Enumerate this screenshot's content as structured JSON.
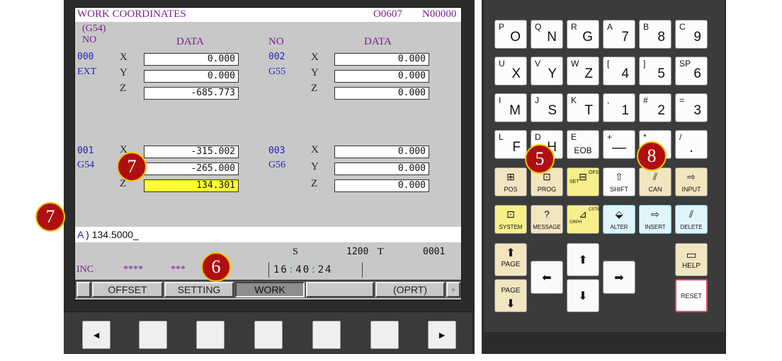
{
  "screen": {
    "title": "WORK COORDINATES",
    "program_no": "O0607",
    "sequence_no": "N00000",
    "header": {
      "g54_tag": "(G54)",
      "no_left": "NO",
      "data_left": "DATA",
      "no_right": "NO",
      "data_right": "DATA"
    },
    "blocks": [
      {
        "no": "000",
        "code": "EXT",
        "x": "0.000",
        "y": "0.000",
        "z": "-685.773"
      },
      {
        "no": "002",
        "code": "G55",
        "x": "0.000",
        "y": "0.000",
        "z": "0.000"
      },
      {
        "no": "001",
        "code": "G54",
        "x": "-315.002",
        "y": "-265.000",
        "z": "134.301"
      },
      {
        "no": "003",
        "code": "G56",
        "x": "0.000",
        "y": "0.000",
        "z": "0.000"
      }
    ],
    "axes": {
      "x": "X",
      "y": "Y",
      "z": "Z"
    },
    "input_prefix": "A",
    "input_value": " ) 134.5000_",
    "spindle_label": "S",
    "spindle_value": "1200",
    "tool_label": "T",
    "tool_value": "0001",
    "mode": "INC",
    "stars1": "****",
    "stars2": "***",
    "clock_h": "16",
    "clock_m": "40",
    "clock_s": "24",
    "softkeys": [
      "OFFSET",
      "SETTING",
      "WORK",
      "",
      "(OPRT)",
      "+"
    ]
  },
  "hw_keys": {
    "left": "◄",
    "right": "►"
  },
  "keypad": {
    "row1": [
      {
        "sm": "P",
        "lg": "O"
      },
      {
        "sm": "Q",
        "lg": "N"
      },
      {
        "sm": "R",
        "lg": "G"
      },
      {
        "sm": "A",
        "lg": "7"
      },
      {
        "sm": "B",
        "lg": "8"
      },
      {
        "sm": "C",
        "lg": "9"
      }
    ],
    "row2": [
      {
        "sm": "U",
        "lg": "X"
      },
      {
        "sm": "V",
        "lg": "Y"
      },
      {
        "sm": "W",
        "lg": "Z"
      },
      {
        "sm": "[",
        "lg": "4"
      },
      {
        "sm": "]",
        "lg": "5"
      },
      {
        "sm": "SP",
        "lg": "6"
      }
    ],
    "row3": [
      {
        "sm": "I",
        "lg": "M"
      },
      {
        "sm": "J",
        "lg": "S"
      },
      {
        "sm": "K",
        "lg": "T"
      },
      {
        "sm": ",",
        "lg": "1"
      },
      {
        "sm": "#",
        "lg": "2"
      },
      {
        "sm": "=",
        "lg": "3"
      }
    ],
    "row4": [
      {
        "sm": "L",
        "lg": "F"
      },
      {
        "sm": "D",
        "lg": "H"
      },
      {
        "sm": "E",
        "lg": "EOB"
      },
      {
        "sm": "+",
        "lg": "—"
      },
      {
        "sm": "*",
        "lg": "0"
      },
      {
        "sm": "/",
        "lg": "."
      }
    ],
    "func1": [
      "POS",
      "PROG",
      "OFS/SET",
      "SHIFT",
      "CAN",
      "INPUT"
    ],
    "func2": [
      "SYSTEM",
      "MESSAGE",
      "CSTM/GRPH",
      "ALTER",
      "INSERT",
      "DELETE"
    ],
    "page_up": "PAGE",
    "page_down": "PAGE",
    "help": "HELP",
    "reset": "RESET",
    "ofs_small": "OFS",
    "set_small": "SET",
    "cstm_small": "CSTM",
    "grph_small": "GRPH"
  },
  "badges": {
    "b5": "5",
    "b6": "6",
    "b7a": "7",
    "b7b": "7",
    "b8": "8"
  }
}
